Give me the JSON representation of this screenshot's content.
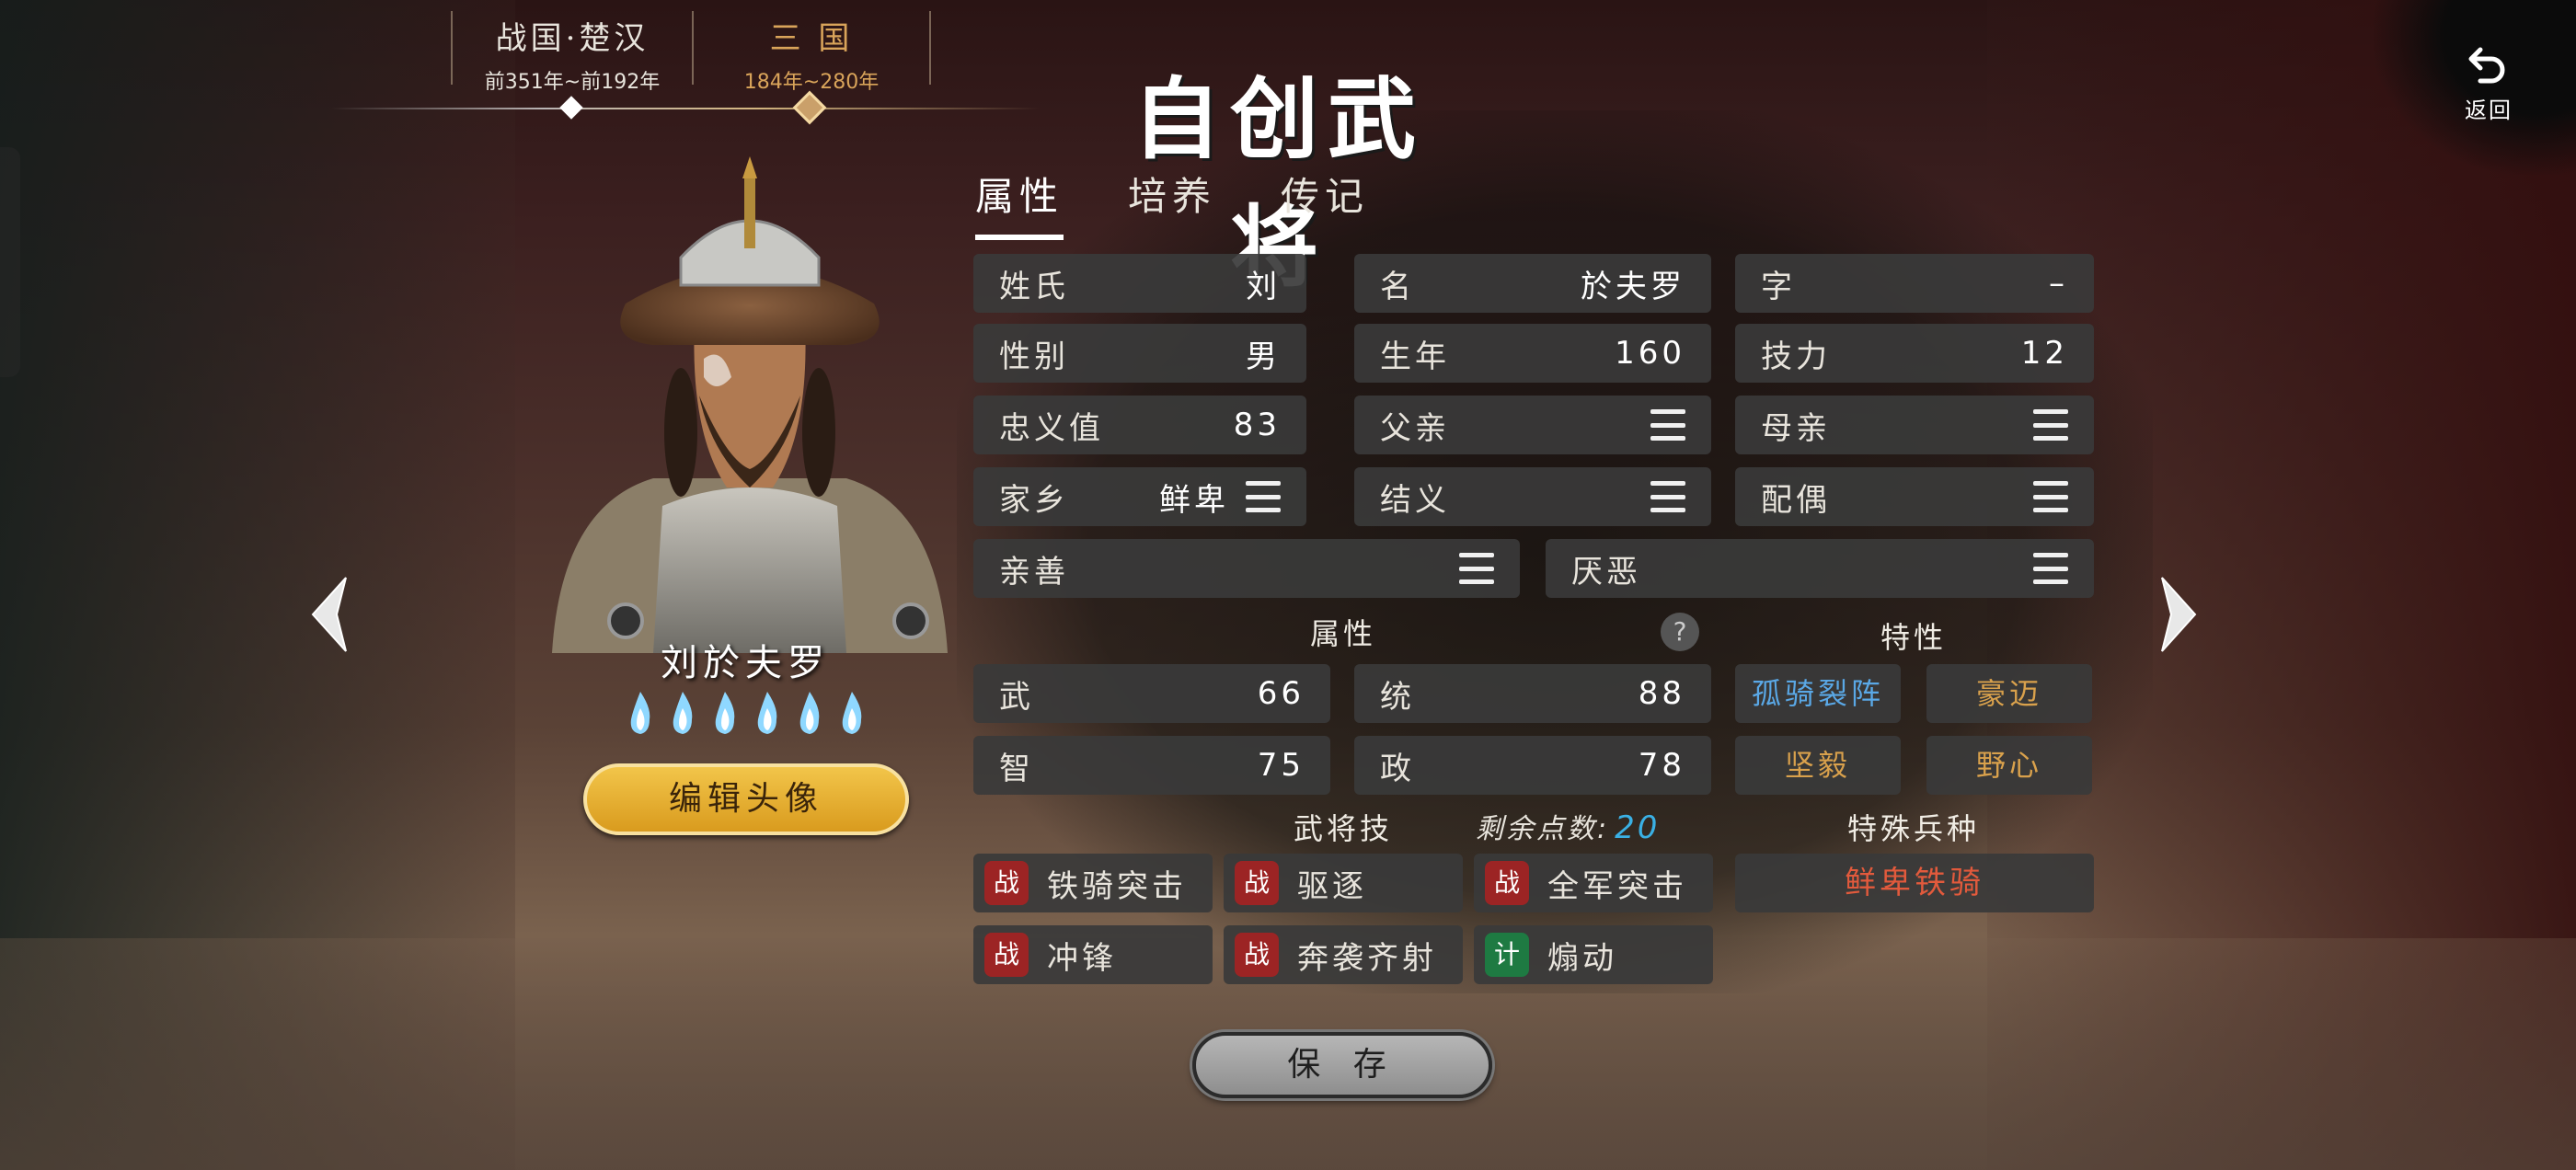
{
  "eras": [
    {
      "name": "战国·楚汉",
      "dates": "前351年~前192年",
      "active": false
    },
    {
      "name": "三 国",
      "dates": "184年~280年",
      "active": true
    }
  ],
  "title": "自创武将",
  "back": {
    "label": "返回",
    "icon": "undo-arrow-icon"
  },
  "tabs": [
    "属性",
    "培养",
    "传记"
  ],
  "general": {
    "name": "刘於夫罗",
    "flames": 6,
    "edit_avatar_label": "编辑头像"
  },
  "profile": {
    "surname": {
      "label": "姓氏",
      "value": "刘"
    },
    "given_name": {
      "label": "名",
      "value": "於夫罗"
    },
    "courtesy": {
      "label": "字",
      "value": "–"
    },
    "gender": {
      "label": "性别",
      "value": "男"
    },
    "birth_year": {
      "label": "生年",
      "value": "160"
    },
    "skill_power": {
      "label": "技力",
      "value": "12"
    },
    "loyalty": {
      "label": "忠义值",
      "value": "83"
    },
    "father": {
      "label": "父亲"
    },
    "mother": {
      "label": "母亲"
    },
    "hometown": {
      "label": "家乡",
      "value": "鲜卑"
    },
    "sworn": {
      "label": "结义"
    },
    "spouse": {
      "label": "配偶"
    },
    "likes": {
      "label": "亲善"
    },
    "dislikes": {
      "label": "厌恶"
    }
  },
  "attributes": {
    "heading": "属性",
    "help": "?",
    "war": {
      "label": "武",
      "value": "66"
    },
    "lead": {
      "label": "统",
      "value": "88"
    },
    "intel": {
      "label": "智",
      "value": "75"
    },
    "politics": {
      "label": "政",
      "value": "78"
    }
  },
  "traits": {
    "heading": "特性",
    "items": [
      {
        "label": "孤骑裂阵",
        "color": "#5aa8e6"
      },
      {
        "label": "豪迈",
        "color": "#d9a14c"
      },
      {
        "label": "坚毅",
        "color": "#d9a14c"
      },
      {
        "label": "野心",
        "color": "#d9a14c"
      }
    ]
  },
  "skills": {
    "heading": "武将技",
    "remaining_label": "剩余点数:",
    "remaining_value": "20",
    "items": [
      {
        "type": "战",
        "label": "铁骑突击"
      },
      {
        "type": "战",
        "label": "驱逐"
      },
      {
        "type": "战",
        "label": "全军突击"
      },
      {
        "type": "战",
        "label": "冲锋"
      },
      {
        "type": "战",
        "label": "奔袭齐射"
      },
      {
        "type": "计",
        "label": "煽动"
      }
    ]
  },
  "special_unit": {
    "heading": "特殊兵种",
    "value": "鲜卑铁骑",
    "color": "#e25a3c"
  },
  "save_label": "保 存",
  "colors": {
    "accent_gold": "#d9a45a",
    "war_badge": "#9c2424",
    "plan_badge": "#1e7a42"
  }
}
